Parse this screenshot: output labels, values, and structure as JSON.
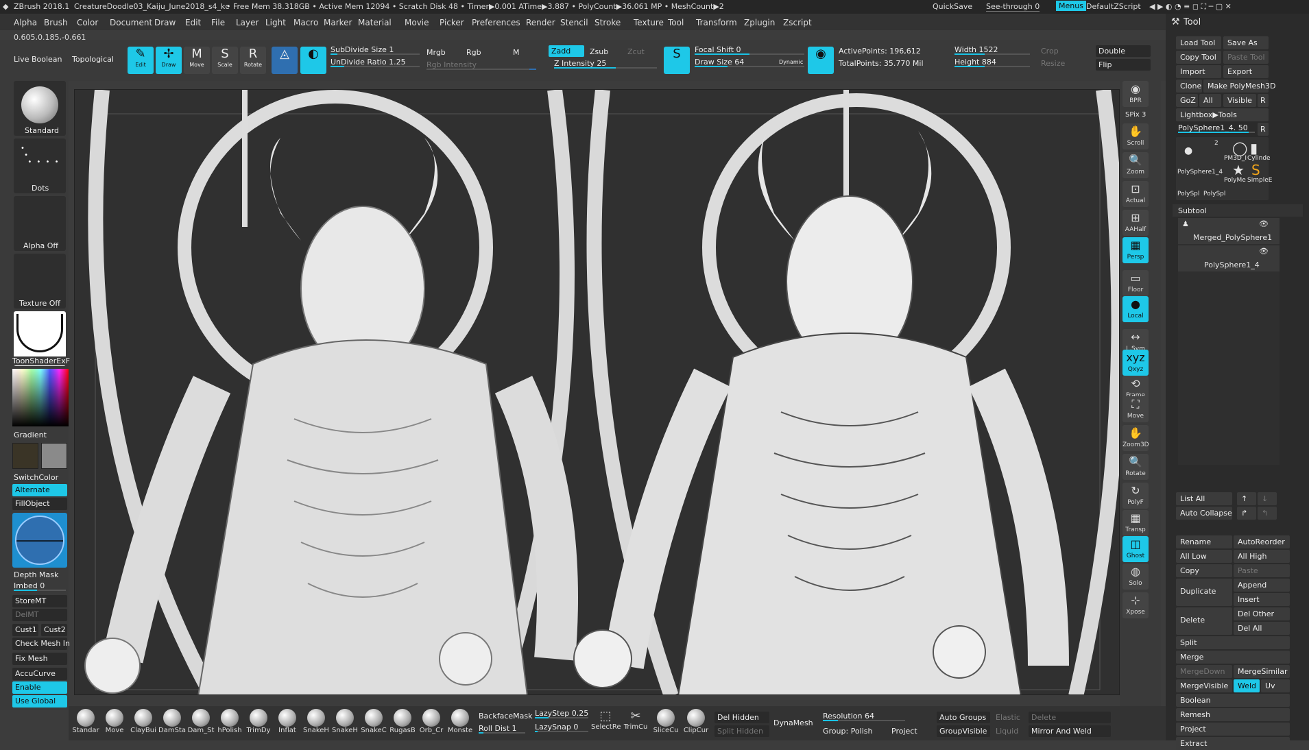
{
  "titlebar": {
    "app": "ZBrush 2018.1",
    "doc": "CreatureDoodle03_Kaiju_June2018_s4_kc",
    "stats": "• Free Mem 38.318GB • Active Mem 12094 • Scratch Disk 48 • Timer▶0.001 ATime▶3.887 • PolyCount▶36.061 MP • MeshCount▶2",
    "quicksave": "QuickSave",
    "seethrough": "See-through  0",
    "menus": "Menus",
    "script": "DefaultZScript"
  },
  "menubar": [
    "Alpha",
    "Brush",
    "Color",
    "Document",
    "Draw",
    "Edit",
    "File",
    "Layer",
    "Light",
    "Macro",
    "Marker",
    "Material",
    "Movie",
    "Picker",
    "Preferences",
    "Render",
    "Stencil",
    "Stroke",
    "Texture",
    "Tool",
    "Transform",
    "Zplugin",
    "Zscript"
  ],
  "coords": "0.605,0.185,-0.661",
  "topshelf": {
    "live_boolean": "Live Boolean",
    "topological": "Topological",
    "edit": "Edit",
    "draw": "Draw",
    "move": "Move",
    "scale": "Scale",
    "rotate": "Rotate",
    "subdivide": "SubDivide Size 1",
    "undivide": "UnDivide Ratio 1.25",
    "mrgb": "Mrgb",
    "rgb": "Rgb",
    "m": "M",
    "rgb_intensity": "Rgb Intensity",
    "zadd": "Zadd",
    "zsub": "Zsub",
    "zcut": "Zcut",
    "z_intensity": "Z Intensity 25",
    "focal_shift": "Focal Shift 0",
    "draw_size": "Draw Size 64",
    "dynamic": "Dynamic",
    "active_points": "ActivePoints: 196,612",
    "total_points": "TotalPoints: 35.770 Mil",
    "width": "Width 1522",
    "height": "Height 884",
    "crop": "Crop",
    "resize": "Resize",
    "double": "Double",
    "flip": "Flip"
  },
  "leftshelf": {
    "brush": "Standard",
    "stroke": "Dots",
    "alpha": "Alpha Off",
    "texture": "Texture Off",
    "material": "ToonShaderExF",
    "gradient": "Gradient",
    "switchcolor": "SwitchColor",
    "alternate": "Alternate",
    "fillobject": "FillObject",
    "depth_mask": "Depth Mask",
    "imbed": "Imbed 0",
    "storemt": "StoreMT",
    "delmt": "DelMT",
    "cust1": "Cust1",
    "cust2": "Cust2",
    "check_mesh": "Check Mesh In",
    "fix_mesh": "Fix Mesh",
    "accucurve": "AccuCurve",
    "enable": "Enable",
    "use_global": "Use Global"
  },
  "rightshelf": [
    "BPR",
    "SPix 3",
    "Scroll",
    "Zoom",
    "Actual",
    "AAHalf",
    "Persp",
    "Floor",
    "Local",
    "L.Sym",
    "Qxyz",
    "Frame",
    "Move",
    "Zoom3D",
    "Rotate",
    "PolyF",
    "Transp",
    "Ghost",
    "Solo",
    "Xpose"
  ],
  "toolpanel": {
    "title": "Tool",
    "load_tool": "Load Tool",
    "save_as": "Save As",
    "copy_tool": "Copy Tool",
    "paste_tool": "Paste Tool",
    "import": "Import",
    "export": "Export",
    "clone": "Clone",
    "make_polymesh": "Make PolyMesh3D",
    "goz": "GoZ",
    "all": "All",
    "visible": "Visible",
    "r": "R",
    "lightbox_tools": "Lightbox▶Tools",
    "polysphere_slider": "PolySphere1_4. 50",
    "thumb_names": [
      "PM3D_I",
      "Cylinde",
      "PolySphere1_4",
      "PolyMe",
      "SimpleE",
      "PolySpl",
      "PolySpl"
    ],
    "thumb_count": "2",
    "subtool": "Subtool",
    "subtool_items": [
      "Merged_PolySphere1",
      "PolySphere1_4"
    ],
    "list_all": "List All",
    "auto_collapse": "Auto Collapse",
    "rename": "Rename",
    "autoreorder": "AutoReorder",
    "all_low": "All Low",
    "all_high": "All High",
    "copy": "Copy",
    "paste": "Paste",
    "duplicate": "Duplicate",
    "append": "Append",
    "insert": "Insert",
    "delete": "Delete",
    "del_other": "Del Other",
    "del_all": "Del All",
    "split": "Split",
    "merge": "Merge",
    "mergedown": "MergeDown",
    "mergesimilar": "MergeSimilar",
    "mergevisible": "MergeVisible",
    "weld": "Weld",
    "uv": "Uv",
    "boolean": "Boolean",
    "remesh": "Remesh",
    "project": "Project",
    "extract": "Extract"
  },
  "bottomshelf": {
    "brushes": [
      "Standar",
      "Move",
      "ClayBui",
      "DamSta",
      "Dam_St",
      "hPolish",
      "TrimDy",
      "Inflat",
      "SnakeH",
      "SnakeH",
      "SnakeC",
      "RugasB",
      "Orb_Cr",
      "Monste"
    ],
    "backfacemask": "BackfaceMask",
    "roll_dist": "Roll Dist 1",
    "lazystep": "LazyStep 0.25",
    "lazysnap": "LazySnap 0",
    "tools": [
      "SelectRe",
      "TrimCu",
      "SliceCu",
      "ClipCur"
    ],
    "del_hidden": "Del Hidden",
    "split_hidden": "Split Hidden",
    "dynamesh": "DynaMesh",
    "resolution": "Resolution 64",
    "group_polish": "Group: Polish",
    "project": "Project",
    "auto_groups": "Auto Groups",
    "elastic": "Elastic",
    "delete": "Delete",
    "groupvisible": "GroupVisible",
    "liquid": "Liquid",
    "mirror_weld": "Mirror And Weld"
  }
}
